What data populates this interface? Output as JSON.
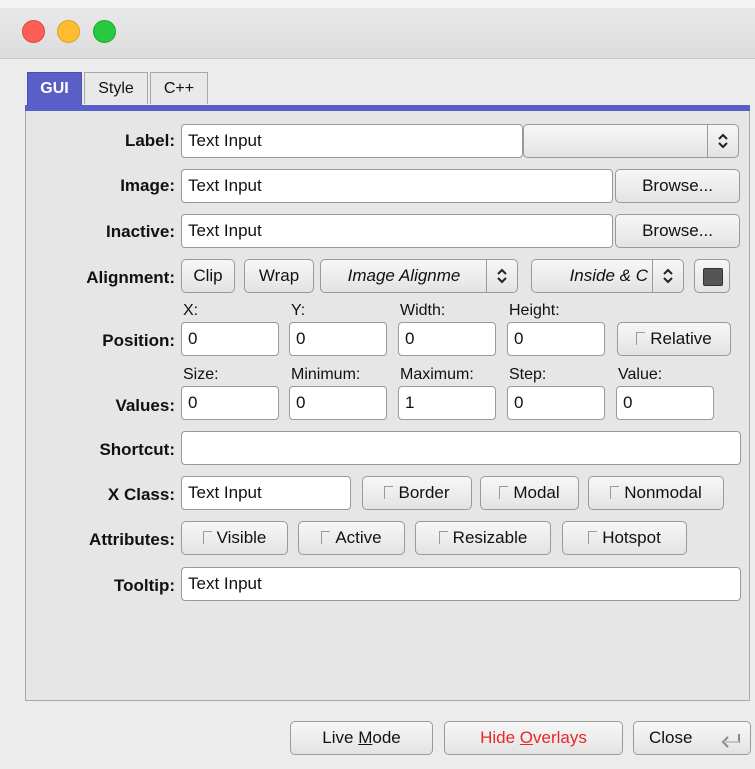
{
  "tabs": [
    "GUI",
    "Style",
    "C++"
  ],
  "labels": {
    "label": "Label:",
    "image": "Image:",
    "inactive": "Inactive:",
    "alignment": "Alignment:",
    "position": "Position:",
    "values": "Values:",
    "shortcut": "Shortcut:",
    "xclass": "X Class:",
    "attributes": "Attributes:",
    "tooltip": "Tooltip:"
  },
  "label_field": "Text Input",
  "image_field": "Text Input",
  "inactive_field": "Text Input",
  "browse_label": "Browse...",
  "alignment": {
    "clip": "Clip",
    "wrap": "Wrap",
    "image_alignment": "Image Alignme",
    "inside": "Inside & C"
  },
  "position": {
    "headers": [
      "X:",
      "Y:",
      "Width:",
      "Height:"
    ],
    "values": [
      "0",
      "0",
      "0",
      "0"
    ],
    "relative": "Relative"
  },
  "values": {
    "headers": [
      "Size:",
      "Minimum:",
      "Maximum:",
      "Step:",
      "Value:"
    ],
    "values": [
      "0",
      "0",
      "1",
      "0",
      "0"
    ]
  },
  "shortcut_field": "",
  "xclass": {
    "field": "Text Input",
    "border": "Border",
    "modal": "Modal",
    "nonmodal": "Nonmodal"
  },
  "attributes": {
    "visible": "Visible",
    "active": "Active",
    "resizable": "Resizable",
    "hotspot": "Hotspot"
  },
  "tooltip_field": "Text Input",
  "footer": {
    "live_mode_pre": "Live ",
    "live_mode_u": "M",
    "live_mode_post": "ode",
    "hide_overlays_pre": "Hide ",
    "hide_overlays_u": "O",
    "hide_overlays_post": "verlays",
    "close": "Close"
  },
  "colors": {
    "tab_active": "#5a5fc8",
    "hide_overlays_text": "#e8282a"
  }
}
